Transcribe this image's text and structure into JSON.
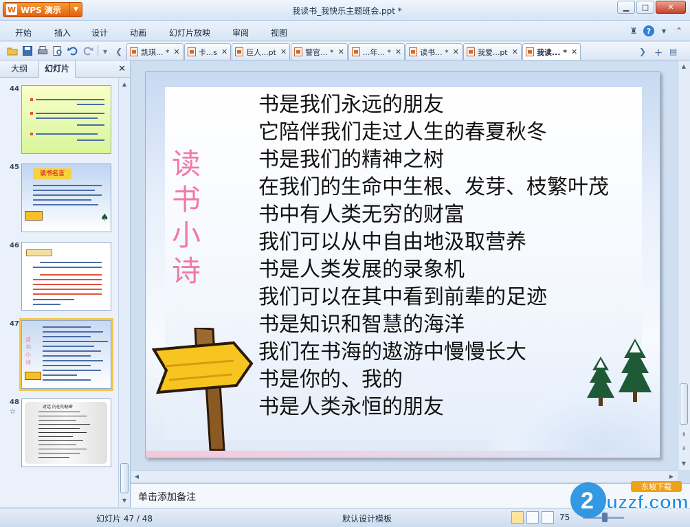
{
  "app": {
    "button_label": "WPS 演示",
    "logo_glyph": "W",
    "document_title": "我读书_我快乐主题班会.ppt *"
  },
  "menu": [
    "开始",
    "插入",
    "设计",
    "动画",
    "幻灯片放映",
    "审阅",
    "视图"
  ],
  "doc_tabs": [
    {
      "label": "凯琪... *"
    },
    {
      "label": "卡...s"
    },
    {
      "label": "巨人...pt"
    },
    {
      "label": "警官... *"
    },
    {
      "label": "...年... *"
    },
    {
      "label": "读书... *"
    },
    {
      "label": "我爱...pt"
    },
    {
      "label": "我读... *",
      "active": true
    }
  ],
  "left_panel": {
    "tabs": [
      {
        "label": "大纲"
      },
      {
        "label": "幻灯片",
        "active": true
      }
    ],
    "slide_numbers": [
      "44",
      "45",
      "46",
      "47",
      "48"
    ],
    "thumb_title_45": "读书名言",
    "thumb_title_48": "对话 内在的秘密",
    "thumb_title_47": "读书小诗"
  },
  "slide": {
    "title_chars": [
      "读",
      "书",
      "小",
      "诗"
    ],
    "lines": [
      "书是我们永远的朋友",
      "它陪伴我们走过人生的春夏秋冬",
      "书是我们的精神之树",
      "在我们的生命中生根、发芽、枝繁叶茂",
      "书中有人类无穷的财富",
      "我们可以从中自由地汲取营养",
      "书是人类发展的录象机",
      "我们可以在其中看到前辈的足迹",
      "书是知识和智慧的海洋",
      "我们在书海的遨游中慢慢长大",
      "书是你的、我的",
      "书是人类永恒的朋友"
    ]
  },
  "notes": {
    "placeholder": "单击添加备注"
  },
  "status": {
    "slide_counter": "幻灯片 47 / 48",
    "template": "默认设计模板",
    "zoom": "75"
  },
  "watermark": {
    "brand": "uzzf.com",
    "tag": "东坡下载"
  },
  "colors": {
    "accent_orange": "#e2620c",
    "title_pink": "#f07aa6",
    "chrome_blue": "#d8e6f5"
  }
}
